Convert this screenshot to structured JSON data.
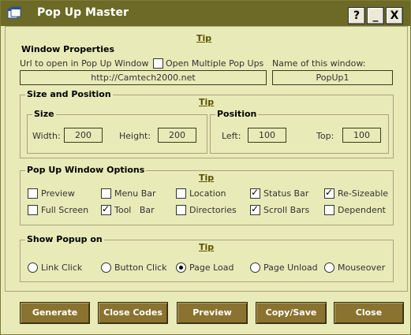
{
  "window": {
    "title": "Pop Up Master",
    "controls": {
      "help": "?",
      "minimize": "_",
      "close": "X"
    }
  },
  "tips": {
    "top": "Tip",
    "size": "Tip",
    "options": "Tip",
    "show": "Tip"
  },
  "window_properties": {
    "legend": "Window Properties",
    "url_label": "Url to open in Pop Up Window",
    "url_value": "http://Camtech2000.net",
    "multiple_label": "Open Multiple Pop Ups",
    "multiple_checked": false,
    "name_label": "Name of this window:",
    "name_value": "PopUp1"
  },
  "size_position": {
    "legend": "Size and Position",
    "size_legend": "Size",
    "width_label": "Width:",
    "width_value": "200",
    "height_label": "Height:",
    "height_value": "200",
    "position_legend": "Position",
    "left_label": "Left:",
    "left_value": "100",
    "top_label": "Top:",
    "top_value": "100"
  },
  "options": {
    "legend": "Pop Up Window Options",
    "items": [
      {
        "label": "Preview",
        "checked": false
      },
      {
        "label": "Menu Bar",
        "checked": false
      },
      {
        "label": "Location",
        "checked": false
      },
      {
        "label": "Status Bar",
        "checked": true
      },
      {
        "label": "Re-Sizeable",
        "checked": true
      },
      {
        "label": "Full Screen",
        "checked": false
      },
      {
        "label": "Tool   Bar",
        "checked": true
      },
      {
        "label": "Directories",
        "checked": false
      },
      {
        "label": "Scroll Bars",
        "checked": true
      },
      {
        "label": "Dependent",
        "checked": false
      }
    ]
  },
  "show_popup": {
    "legend": "Show Popup on",
    "items": [
      {
        "label": "Link Click",
        "selected": false
      },
      {
        "label": "Button Click",
        "selected": false
      },
      {
        "label": "Page Load",
        "selected": true
      },
      {
        "label": "Page Unload",
        "selected": false
      },
      {
        "label": "Mouseover",
        "selected": false
      }
    ]
  },
  "buttons": {
    "generate": "Generate",
    "close_codes": "Close Codes",
    "preview": "Preview",
    "copy_save": "Copy/Save",
    "close": "Close"
  },
  "colors": {
    "titlebar": "#6c6a26",
    "background": "#e8eab8",
    "button": "#8a7330"
  }
}
